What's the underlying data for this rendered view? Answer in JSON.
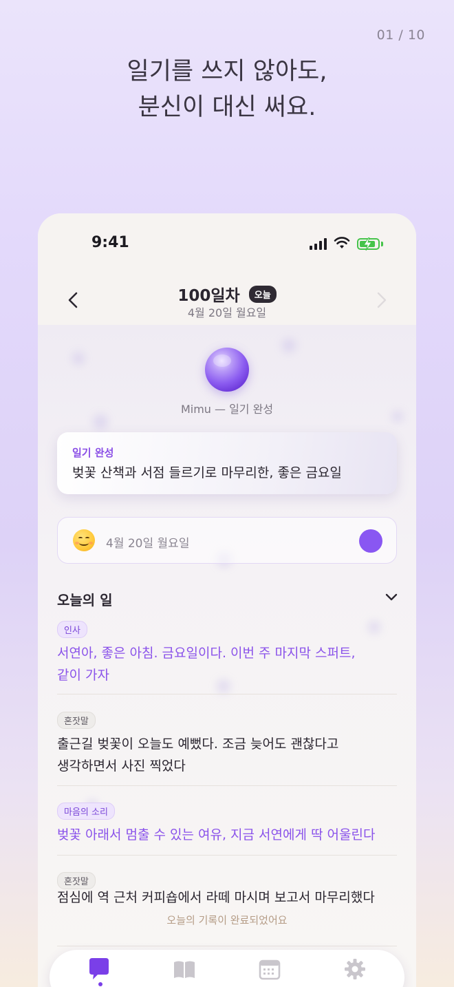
{
  "page_counter": "01 / 10",
  "headline": {
    "line1": "일기를 쓰지 않아도,",
    "line2": "분신이 대신 써요."
  },
  "status_bar": {
    "time": "9:41"
  },
  "nav": {
    "title": "100일차",
    "badge": "오늘",
    "subtitle": "4월 20일 월요일"
  },
  "avatar": {
    "caption": "Mimu — 일기 완성"
  },
  "summary": {
    "label": "일기 완성",
    "text": "벚꽃 산책과 서점 들르기로 마무리한, 좋은 금요일"
  },
  "mood": {
    "date": "4월 20일 월요일",
    "emoji": "smiling-face",
    "accent_color": "#8957f2"
  },
  "section": {
    "title": "오늘의 일"
  },
  "entries": [
    {
      "tag": "인사",
      "line1": "서연아, 좋은 아침. 금요일이다. 이번 주 마지막 스퍼트,",
      "line2": "같이 가자"
    },
    {
      "tag": "혼잣말",
      "line1": "출근길 벚꽃이 오늘도 예뻤다. 조금 늦어도 괜찮다고",
      "line2": "생각하면서 사진 찍었다"
    },
    {
      "tag": "마음의 소리",
      "line1": "벚꽃 아래서 멈출 수 있는 여유, 지금 서연에게 딱 어울린다"
    },
    {
      "tag": "혼잣말",
      "line1": "점심에 역 근처 커피숍에서 라떼 마시며 보고서 마무리했다"
    }
  ],
  "complete_note": "오늘의 기록이 완료되었어요",
  "tabs": [
    {
      "icon": "chat-bubble-icon",
      "active": true
    },
    {
      "icon": "book-icon",
      "active": false
    },
    {
      "icon": "calendar-icon",
      "active": false
    },
    {
      "icon": "gear-icon",
      "active": false
    }
  ],
  "colors": {
    "accent": "#8a52ea",
    "tag_purple_bg": "#eee4fd",
    "tab_active": "#7a3fe8",
    "tab_inactive": "#c9c6cc"
  }
}
